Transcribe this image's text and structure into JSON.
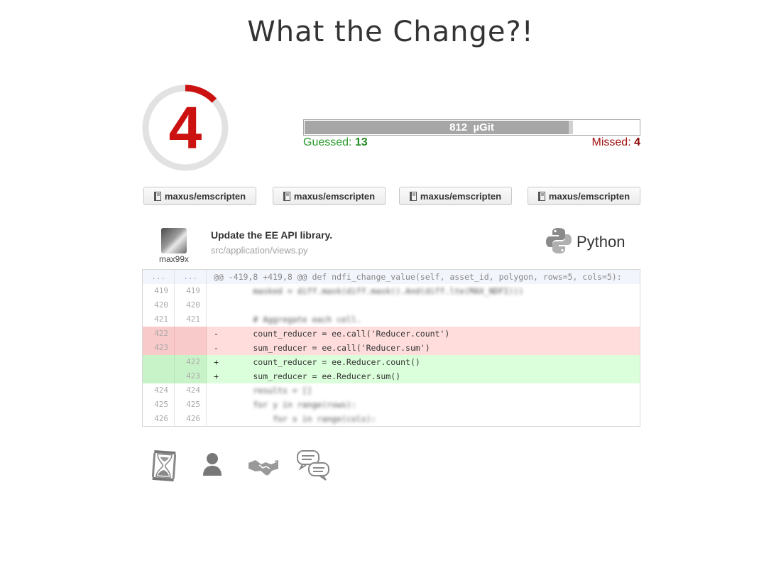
{
  "title": "What the Change?!",
  "timer": {
    "value": "4",
    "remaining_fraction": 0.13,
    "accent": "#cc1111"
  },
  "score": {
    "label": "812  µGit",
    "progress": 0.79,
    "guessed_label": "Guessed: ",
    "guessed_value": "13",
    "missed_label": "Missed: ",
    "missed_value": "4"
  },
  "repos": [
    {
      "label": "maxus/emscripten",
      "icon": "repo-book-icon"
    },
    {
      "label": "maxus/emscripten",
      "icon": "repo-book-icon"
    },
    {
      "label": "maxus/emscripten",
      "icon": "repo-book-icon"
    },
    {
      "label": "maxus/emscripten",
      "icon": "repo-book-icon"
    }
  ],
  "commit": {
    "author": "max99x",
    "message": "Update the EE API library.",
    "file": "src/application/views.py",
    "language": "Python",
    "language_icon": "python-logo-icon"
  },
  "diff": {
    "rows": [
      {
        "type": "hunk",
        "old": "...",
        "new": "...",
        "code": "@@ -419,8 +419,8 @@ def ndfi_change_value(self, asset_id, polygon, rows=5, cols=5):"
      },
      {
        "type": "ctx",
        "old": "419",
        "new": "419",
        "code": "        masked = diff.mask(diff.mask().And(diff.lte(MAX_NDFI)))",
        "blur": true
      },
      {
        "type": "ctx",
        "old": "420",
        "new": "420",
        "code": "",
        "blur": true
      },
      {
        "type": "ctx",
        "old": "421",
        "new": "421",
        "code": "        # Aggregate each cell.",
        "blur": true
      },
      {
        "type": "del",
        "old": "422",
        "new": "",
        "code": "-       count_reducer = ee.call('Reducer.count')"
      },
      {
        "type": "del",
        "old": "423",
        "new": "",
        "code": "-       sum_reducer = ee.call('Reducer.sum')"
      },
      {
        "type": "add",
        "old": "",
        "new": "422",
        "code": "+       count_reducer = ee.Reducer.count()"
      },
      {
        "type": "add",
        "old": "",
        "new": "423",
        "code": "+       sum_reducer = ee.Reducer.sum()"
      },
      {
        "type": "ctx",
        "old": "424",
        "new": "424",
        "code": "        results = []",
        "blur": true
      },
      {
        "type": "ctx",
        "old": "425",
        "new": "425",
        "code": "        for y in range(rows):",
        "blur": true
      },
      {
        "type": "ctx",
        "old": "426",
        "new": "426",
        "code": "            for x in range(cols):",
        "blur": true
      }
    ]
  },
  "tools": [
    {
      "icon": "hourglass-icon"
    },
    {
      "icon": "user-icon"
    },
    {
      "icon": "handshake-icon"
    },
    {
      "icon": "chat-bubbles-icon"
    }
  ]
}
